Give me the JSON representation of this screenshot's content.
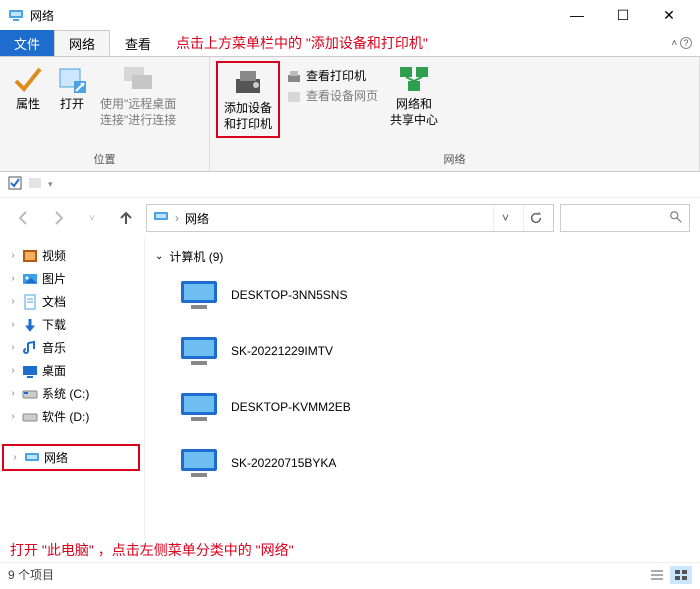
{
  "window": {
    "title": "网络",
    "controls": {
      "min": "—",
      "max": "☐",
      "close": "✕"
    }
  },
  "tabs": {
    "file": "文件",
    "network": "网络",
    "view": "查看",
    "expand_hint": "^"
  },
  "annotations": {
    "top": "点击上方菜单栏中的 \"添加设备和打印机\"",
    "bottom": "打开 \"此电脑\" ，点击左侧菜单分类中的 \"网络\""
  },
  "ribbon": {
    "groups": {
      "location": {
        "label": "位置",
        "properties": "属性",
        "open": "打开",
        "rdp_line1": "使用\"远程桌面",
        "rdp_line2": "连接\"进行连接"
      },
      "network": {
        "label": "网络",
        "add_devices_l1": "添加设备",
        "add_devices_l2": "和打印机",
        "view_printers": "查看打印机",
        "view_device_page": "查看设备网页",
        "net_share_l1": "网络和",
        "net_share_l2": "共享中心"
      }
    }
  },
  "address": {
    "crumb_root": "网络",
    "search_placeholder": ""
  },
  "sidebar": {
    "items": [
      {
        "label": "视频"
      },
      {
        "label": "图片"
      },
      {
        "label": "文档"
      },
      {
        "label": "下载"
      },
      {
        "label": "音乐"
      },
      {
        "label": "桌面"
      },
      {
        "label": "系统 (C:)"
      },
      {
        "label": "软件 (D:)"
      }
    ],
    "network_label": "网络"
  },
  "content": {
    "group_label": "计算机 (9)",
    "items": [
      {
        "name": "DESKTOP-3NN5SNS"
      },
      {
        "name": "SK-20221229IMTV"
      },
      {
        "name": "DESKTOP-KVMM2EB"
      },
      {
        "name": "SK-20220715BYKA"
      }
    ]
  },
  "status": {
    "count_text": "9 个项目"
  }
}
